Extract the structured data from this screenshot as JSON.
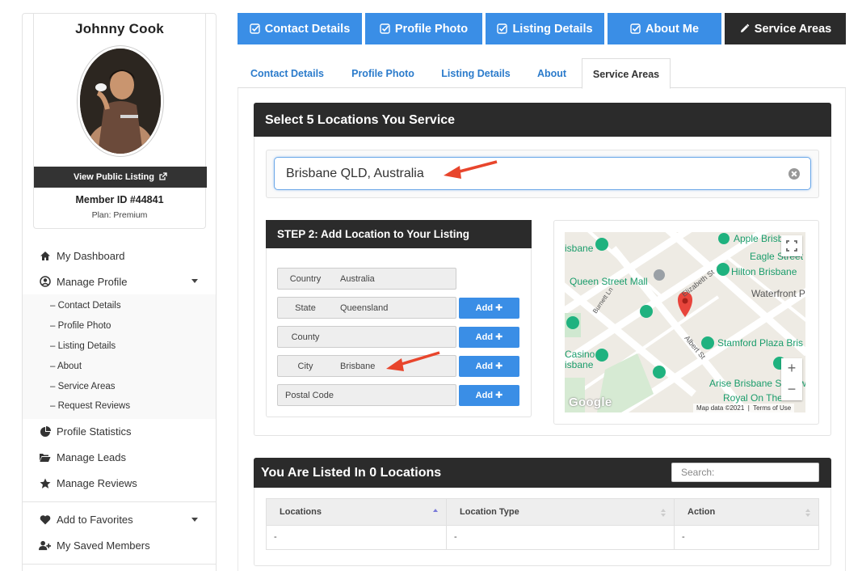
{
  "sidebar": {
    "name": "Johnny Cook",
    "view_public": "View Public Listing",
    "member_id": "Member ID #44841",
    "plan": "Plan: Premium",
    "nav": [
      {
        "label": "My Dashboard",
        "icon": "home-icon"
      },
      {
        "label": "Manage Profile",
        "icon": "user-circle-icon"
      },
      {
        "label": "Profile Statistics",
        "icon": "pie-chart-icon"
      },
      {
        "label": "Manage Leads",
        "icon": "folder-open-icon"
      },
      {
        "label": "Manage Reviews",
        "icon": "star-icon"
      },
      {
        "label": "Add to Favorites",
        "icon": "heart-icon"
      },
      {
        "label": "My Saved Members",
        "icon": "user-plus-icon"
      }
    ],
    "sub": [
      "– Contact Details",
      "– Profile Photo",
      "– Listing Details",
      "– About",
      "– Service Areas",
      "– Request Reviews"
    ]
  },
  "top_tabs": [
    "Contact Details",
    "Profile Photo",
    "Listing Details",
    "About Me",
    "Service Areas"
  ],
  "sub_tabs": [
    "Contact Details",
    "Profile Photo",
    "Listing Details",
    "About",
    "Service Areas"
  ],
  "locations": {
    "title": "Select 5 Locations You Service",
    "input_value": "Brisbane QLD, Australia"
  },
  "step2": {
    "title": "STEP 2: Add Location to Your Listing",
    "add_label": "Add ✚",
    "fields": [
      {
        "label": "Country",
        "value": "Australia"
      },
      {
        "label": "State",
        "value": "Queensland"
      },
      {
        "label": "County",
        "value": ""
      },
      {
        "label": "City",
        "value": "Brisbane"
      },
      {
        "label": "Postal Code",
        "value": ""
      }
    ]
  },
  "map": {
    "labels": [
      "Apple Brisb",
      "Eagle Street",
      "isbane",
      "Hilton Brisbane",
      "Queen Street Mall",
      "Waterfront P",
      "Elizabeth St",
      "Albert St",
      "Burnett Ln",
      "Stamford Plaza Bris",
      "Casino",
      "isbane",
      "Arise Brisbane Skytow",
      "Royal On The"
    ],
    "attribution": "Map data ©2021",
    "terms": "Terms of Use",
    "logo": "Google"
  },
  "listed": {
    "title": "You Are Listed In 0 Locations",
    "search_placeholder": "Search:",
    "columns": [
      "Locations",
      "Location Type",
      "Action"
    ],
    "row": [
      "-",
      "-",
      "-"
    ]
  }
}
